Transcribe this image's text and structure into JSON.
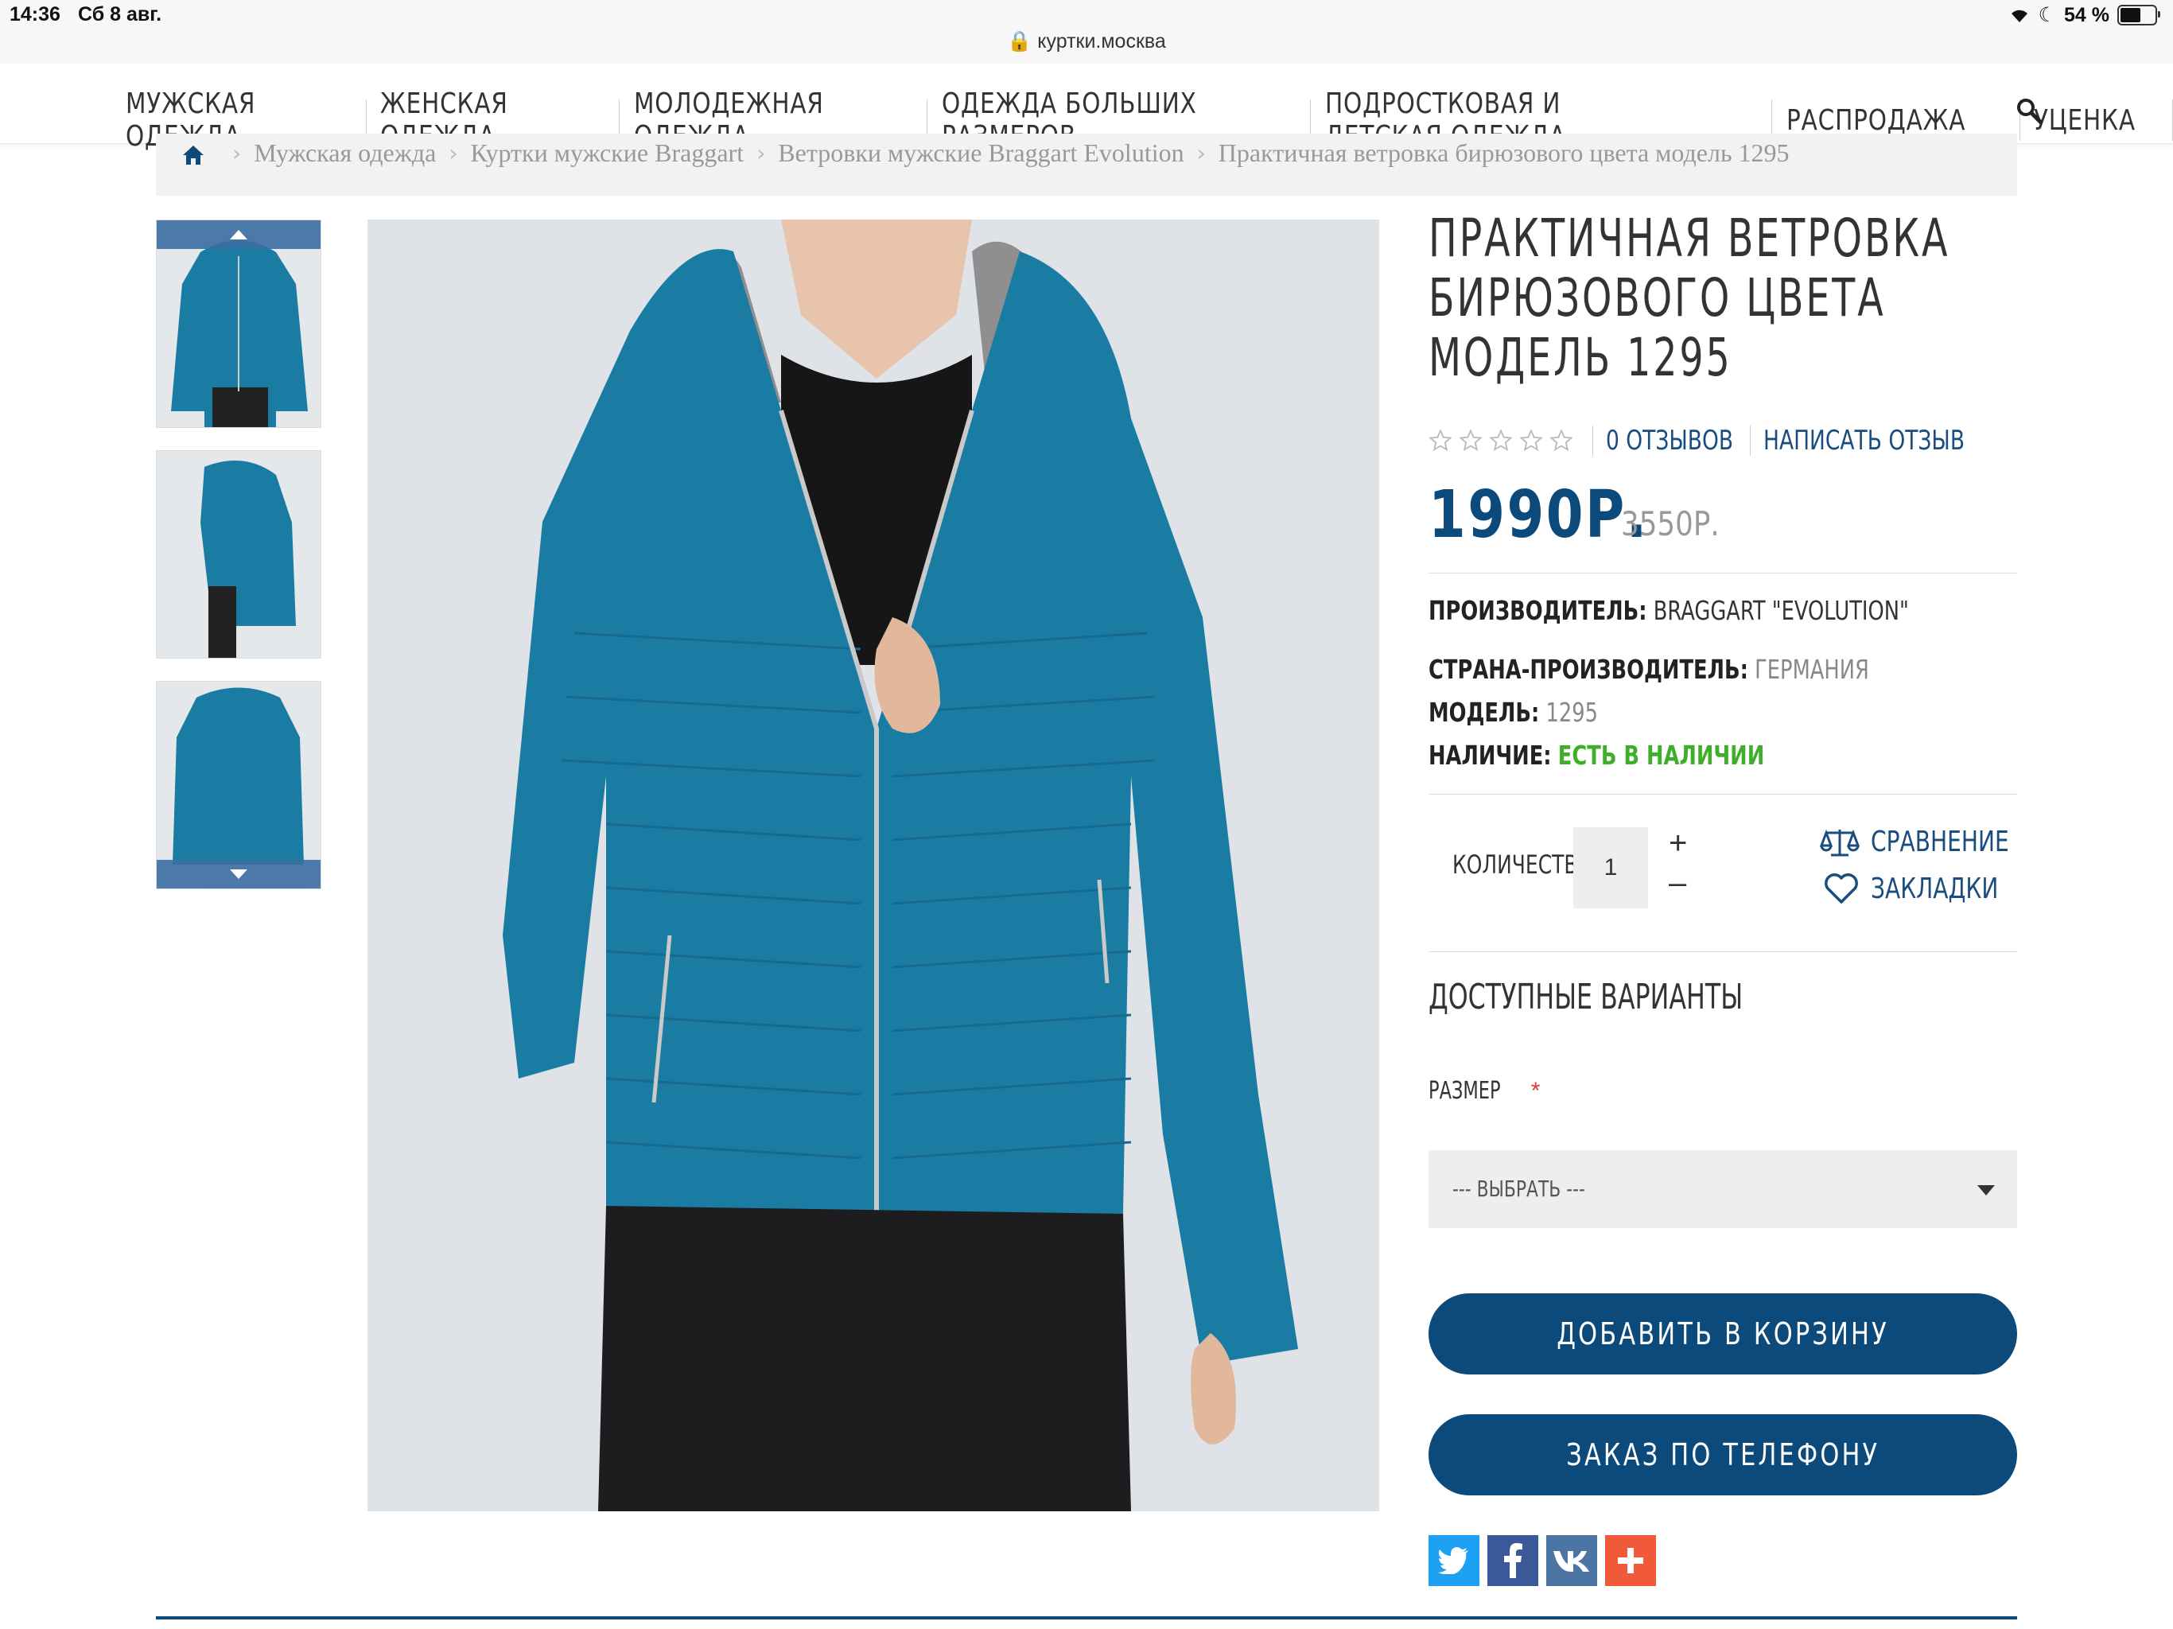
{
  "status_bar": {
    "time": "14:36",
    "date": "Сб 8 авг.",
    "battery": "54 %",
    "url": "куртки.москва"
  },
  "nav": {
    "items": [
      {
        "label": "МУЖСКАЯ ОДЕЖДА"
      },
      {
        "label": "ЖЕНСКАЯ ОДЕЖДА"
      },
      {
        "label": "МОЛОДЕЖНАЯ ОДЕЖДА"
      },
      {
        "label": "ОДЕЖДА БОЛЬШИХ РАЗМЕРОВ"
      },
      {
        "label": "ПОДРОСТКОВАЯ И ДЕТСКАЯ ОДЕЖДА"
      },
      {
        "label": "РАСПРОДАЖА"
      },
      {
        "label": "УЦЕНКА"
      }
    ]
  },
  "breadcrumb": [
    "Мужская одежда",
    "Куртки мужские Braggart",
    "Ветровки мужские Braggart Evolution",
    "Практичная ветровка бирюзового цвета модель 1295"
  ],
  "product": {
    "title_lines": [
      "ПРАКТИЧНАЯ ВЕТРОВКА",
      "БИРЮЗОВОГО ЦВЕТА",
      "МОДЕЛЬ 1295"
    ],
    "rating": 0,
    "reviews_link": "0 ОТЗЫВОВ",
    "write_review_link": "НАПИСАТЬ ОТЗЫВ",
    "price": "1990Р.",
    "old_price": "3550Р.",
    "manufacturer_label": "ПРОИЗВОДИТЕЛЬ:",
    "manufacturer": "BRAGGART \"EVOLUTION\"",
    "country_label": "СТРАНА-ПРОИЗВОДИТЕЛЬ:",
    "country": "ГЕРМАНИЯ",
    "model_label": "МОДЕЛЬ:",
    "model": "1295",
    "availability_label": "НАЛИЧИЕ:",
    "availability": "ЕСТЬ В НАЛИЧИИ"
  },
  "quantity": {
    "label": "КОЛИЧЕСТВО",
    "value": "1",
    "plus": "+",
    "minus": "–"
  },
  "compare_label": "СРАВНЕНИЕ",
  "bookmarks_label": "ЗАКЛАДКИ",
  "variants": {
    "heading": "ДОСТУПНЫЕ ВАРИАНТЫ",
    "size_label": "РАЗМЕР",
    "required_mark": "*",
    "select_value": "--- ВЫБРАТЬ ---"
  },
  "buttons": {
    "add_to_cart": "ДОБАВИТЬ В КОРЗИНУ",
    "phone_order": "ЗАКАЗ ПО ТЕЛЕФОНУ"
  },
  "social": [
    "twitter-icon",
    "facebook-icon",
    "vk-icon",
    "share-plus-icon"
  ],
  "colors": {
    "brand_blue": "#0d4a7c",
    "jacket_teal": "#1b7ca3",
    "in_stock_green": "#3fae2a",
    "twitter": "#1da1f2",
    "facebook": "#3b5998",
    "vk": "#4c75a3",
    "share": "#f05a3a"
  }
}
